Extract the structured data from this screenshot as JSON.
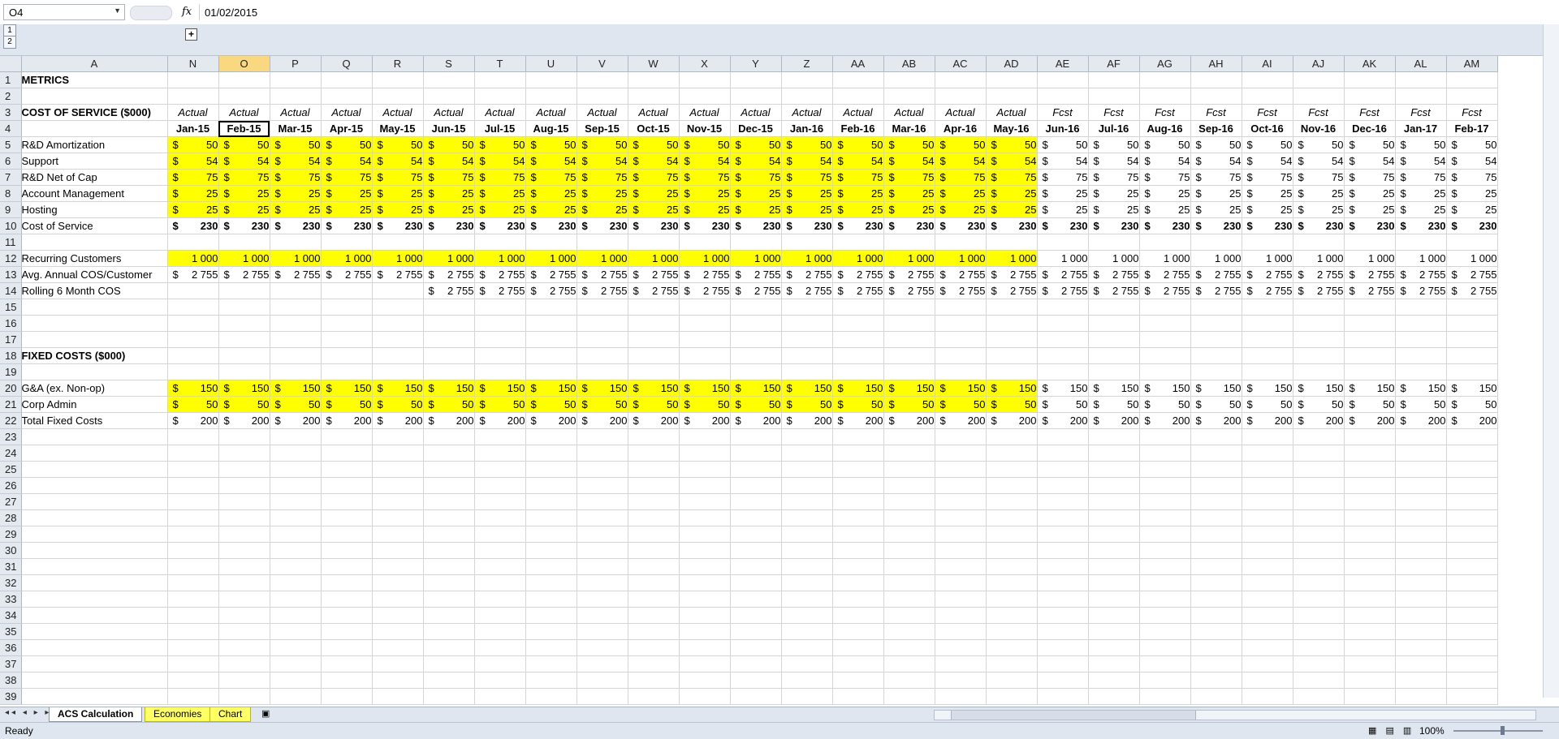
{
  "formula_bar": {
    "name_box": "O4",
    "fx_label": "fx",
    "formula": "01/02/2015"
  },
  "outline_levels": [
    "1",
    "2"
  ],
  "outline_plus": "+",
  "columns": {
    "label_col": "A",
    "data_cols": [
      "N",
      "O",
      "P",
      "Q",
      "R",
      "S",
      "T",
      "U",
      "V",
      "W",
      "X",
      "Y",
      "Z",
      "AA",
      "AB",
      "AC",
      "AD",
      "AE",
      "AF",
      "AG",
      "AH",
      "AI",
      "AJ",
      "AK",
      "AL",
      "AM"
    ],
    "selected": "O"
  },
  "grid": {
    "metrics_title": "METRICS",
    "cos_title": "COST OF SERVICE ($000)",
    "fixed_title": "FIXED COSTS ($000)",
    "types": [
      "Actual",
      "Actual",
      "Actual",
      "Actual",
      "Actual",
      "Actual",
      "Actual",
      "Actual",
      "Actual",
      "Actual",
      "Actual",
      "Actual",
      "Actual",
      "Actual",
      "Actual",
      "Actual",
      "Actual",
      "Fcst",
      "Fcst",
      "Fcst",
      "Fcst",
      "Fcst",
      "Fcst",
      "Fcst",
      "Fcst",
      "Fcst"
    ],
    "dates": [
      "Jan-15",
      "Feb-15",
      "Mar-15",
      "Apr-15",
      "May-15",
      "Jun-15",
      "Jul-15",
      "Aug-15",
      "Sep-15",
      "Oct-15",
      "Nov-15",
      "Dec-15",
      "Jan-16",
      "Feb-16",
      "Mar-16",
      "Apr-16",
      "May-16",
      "Jun-16",
      "Jul-16",
      "Aug-16",
      "Sep-16",
      "Oct-16",
      "Nov-16",
      "Dec-16",
      "Jan-17",
      "Feb-17"
    ],
    "currency": "$",
    "highlight_color": "#ffff00",
    "actual_count": 17,
    "cos_rows": [
      {
        "label": "R&D Amortization",
        "value": "50"
      },
      {
        "label": "Support",
        "value": "54"
      },
      {
        "label": "R&D Net of Cap",
        "value": "75"
      },
      {
        "label": "Account Management",
        "value": "25"
      },
      {
        "label": "Hosting",
        "value": "25"
      }
    ],
    "cos_total": {
      "label": "Cost of Service",
      "value": "230"
    },
    "recurring": {
      "label": "Recurring Customers",
      "value": "1 000"
    },
    "avg_cos": {
      "label": "Avg. Annual COS/Customer",
      "value": "2 755"
    },
    "rolling": {
      "label": "Rolling 6 Month COS",
      "value": "2 755",
      "start_index": 5
    },
    "fixed_rows": [
      {
        "label": "G&A (ex. Non-op)",
        "value": "150"
      },
      {
        "label": "Corp Admin",
        "value": "50"
      }
    ],
    "fixed_total": {
      "label": "Total Fixed Costs",
      "value": "200"
    },
    "row_count": 39
  },
  "sheet_tabs": [
    {
      "label": "ACS Calculation",
      "active": true
    },
    {
      "label": "Economies",
      "active": false
    },
    {
      "label": "Chart",
      "active": false
    }
  ],
  "status": {
    "ready": "Ready",
    "zoom": "100%"
  }
}
